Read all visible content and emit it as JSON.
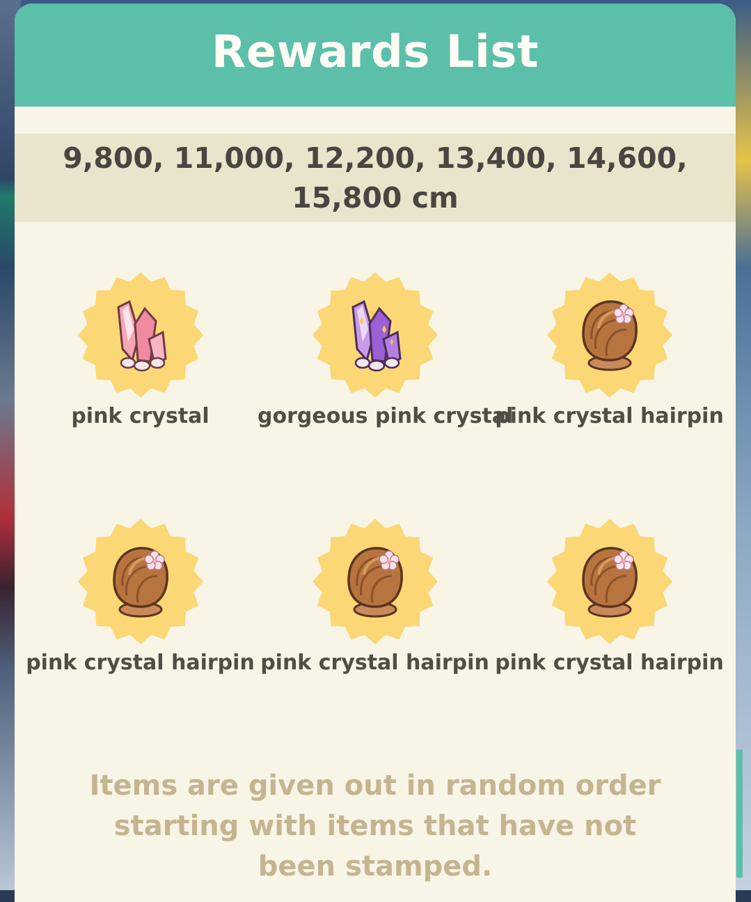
{
  "header": {
    "title": "Rewards List"
  },
  "distances": {
    "line1": "9,800, 11,000, 12,200, 13,400, 14,600,",
    "line2": "15,800 cm"
  },
  "rewards": [
    {
      "label": "pink crystal",
      "icon": "pink-crystal-icon"
    },
    {
      "label": "gorgeous pink crystal",
      "icon": "gorgeous-pink-crystal-icon"
    },
    {
      "label": "pink crystal hairpin",
      "icon": "pink-crystal-hairpin-icon"
    },
    {
      "label": "pink crystal hairpin",
      "icon": "pink-crystal-hairpin-icon"
    },
    {
      "label": "pink crystal hairpin",
      "icon": "pink-crystal-hairpin-icon"
    },
    {
      "label": "pink crystal hairpin",
      "icon": "pink-crystal-hairpin-icon"
    }
  ],
  "footer": {
    "line1": "Items are given out in random order",
    "line2": "starting with items that have not",
    "line3": "been stamped."
  },
  "colors": {
    "header": "#5bbfaa",
    "panel": "#f8f4e6",
    "band": "#ebe4cc",
    "badge": "#fbd776",
    "footer_text": "#c4b591"
  }
}
